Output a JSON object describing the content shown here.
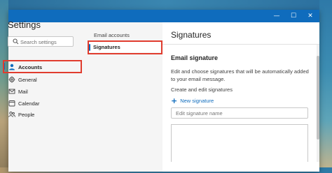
{
  "window": {
    "controls": {
      "minimize": "—",
      "maximize": "☐",
      "close": "✕"
    }
  },
  "nav": {
    "title": "Settings",
    "search_placeholder": "Search settings",
    "items": [
      {
        "label": "Accounts",
        "icon": "person-icon",
        "selected": true
      },
      {
        "label": "General",
        "icon": "gear-icon",
        "selected": false
      },
      {
        "label": "Mail",
        "icon": "mail-icon",
        "selected": false
      },
      {
        "label": "Calendar",
        "icon": "calendar-icon",
        "selected": false
      },
      {
        "label": "People",
        "icon": "people-icon",
        "selected": false
      }
    ]
  },
  "subnav": {
    "heading": "Email accounts",
    "selected_item": "Signatures"
  },
  "content": {
    "title": "Signatures",
    "section_title": "Email signature",
    "description": "Edit and choose signatures that will be automatically added to your email message.",
    "create_label": "Create and edit signatures",
    "new_signature": "New signature",
    "name_placeholder": "Edit signature name"
  },
  "colors": {
    "accent": "#0f6cbd",
    "highlight_box": "#e03c2e",
    "nav_bg": "#f5f5f5"
  }
}
